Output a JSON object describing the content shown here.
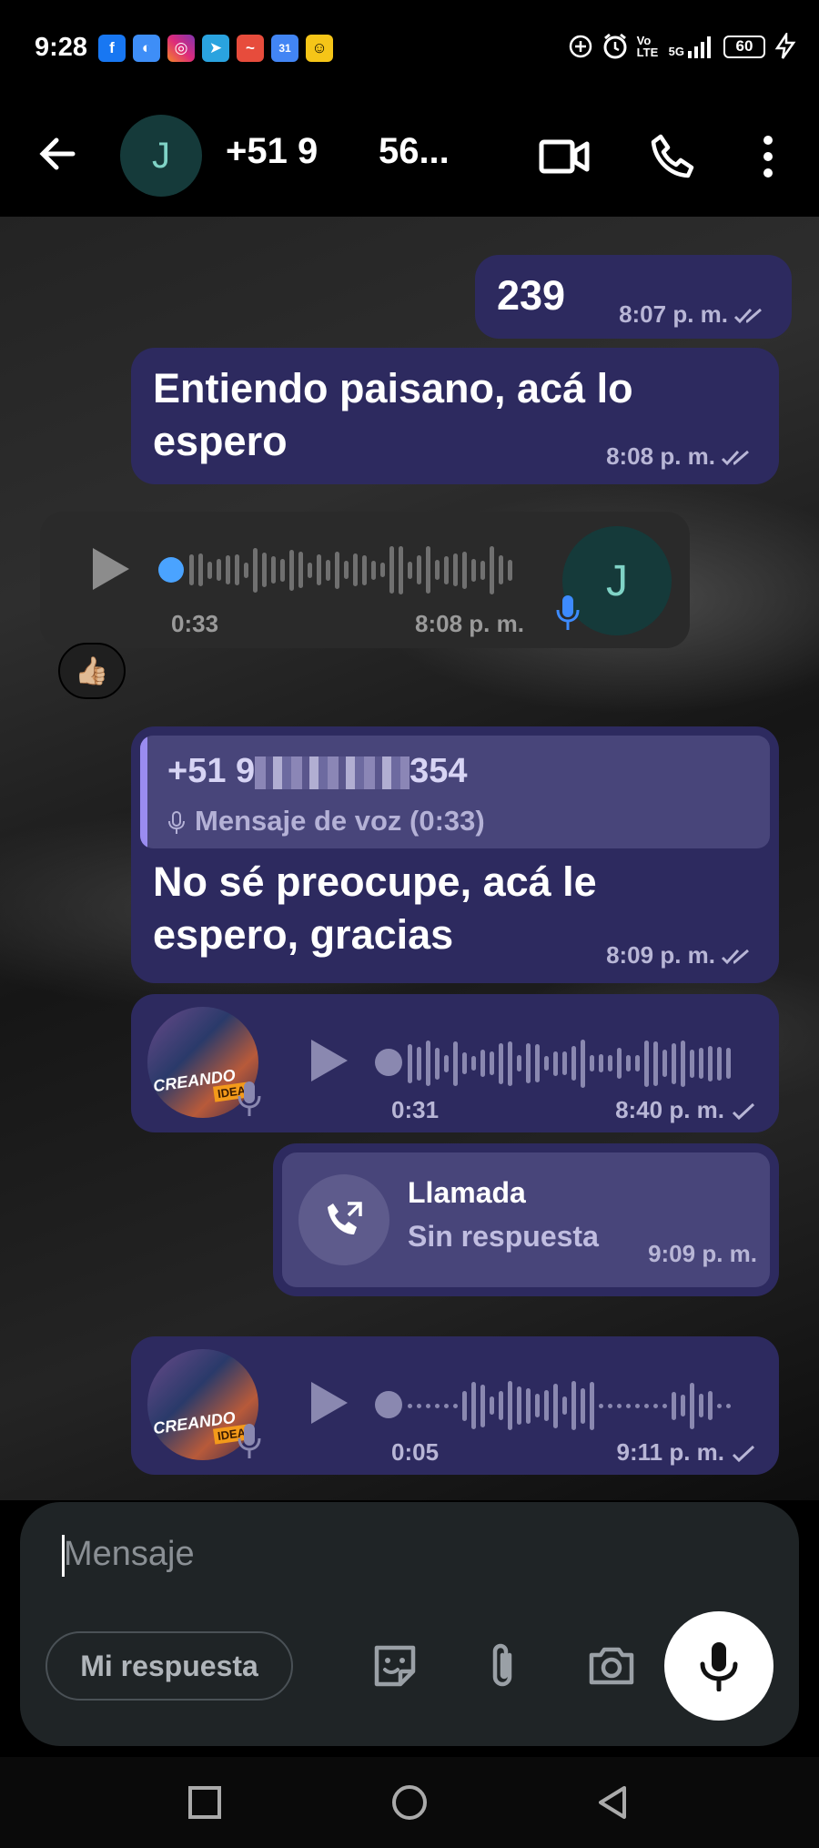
{
  "status": {
    "time": "9:28",
    "network": "5G",
    "volte": "Vo LTE",
    "battery": "60"
  },
  "header": {
    "avatar_initial": "J",
    "contact_name": "+51 9   56..."
  },
  "messages": {
    "m1": {
      "text": "239",
      "time": "8:07 p. m."
    },
    "m2": {
      "text": "Entiendo paisano, acá lo espero",
      "time": "8:08 p. m."
    },
    "m3": {
      "duration": "0:33",
      "time": "8:08 p. m.",
      "avatar_initial": "J",
      "reaction": "👍🏼"
    },
    "m4": {
      "quote_sender_prefix": "+51 9",
      "quote_sender_suffix": "354",
      "quote_text": "Mensaje de voz (0:33)",
      "text": "No sé preocupe, acá le espero, gracias",
      "time": "8:09 p. m."
    },
    "m5": {
      "duration": "0:31",
      "time": "8:40 p. m.",
      "thumb_text": "CREANDO",
      "thumb_tag": "IDEA"
    },
    "m6": {
      "title": "Llamada",
      "subtitle": "Sin respuesta",
      "time": "9:09 p. m."
    },
    "m7": {
      "duration": "0:05",
      "time": "9:11 p. m.",
      "thumb_text": "CREANDO",
      "thumb_tag": "IDEA"
    }
  },
  "composer": {
    "placeholder": "Mensaje",
    "chip_label": "Mi respuesta"
  },
  "colors": {
    "outgoing": "#2d2a5f",
    "incoming": "#2a2a2a",
    "accent": "#4aa3ff",
    "mic_blue": "#3d8bff"
  }
}
